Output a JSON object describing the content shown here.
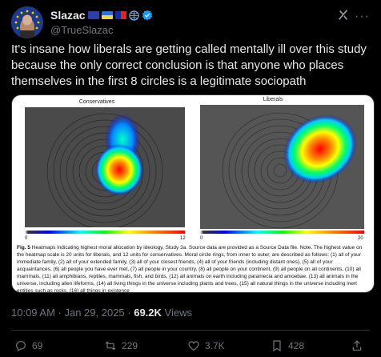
{
  "author": {
    "name": "Slazac",
    "handle": "@TrueSlazac",
    "flags": [
      "eu-flag-icon",
      "ukraine-flag-icon",
      "taiwan-flag-icon",
      "globe-icon"
    ],
    "verified": true
  },
  "post": {
    "text": "It's insane how liberals are getting called mentally ill over this study because the only correct conclusion is that anyone who places themselves in the first 8 circles is a legitimate sociopath"
  },
  "figure": {
    "left_title": "Conservatives",
    "right_title": "Liberals",
    "left_scale_min": "0",
    "left_scale_max": "12",
    "right_scale_min": "0",
    "right_scale_max": "20",
    "caption_label": "Fig. 5",
    "caption_text": " Heatmaps indicating highest moral allocation by ideology, Study 3a. Source data are provided as a Source Data file. Note. The highest value on the heatmap scale is 20 units for liberals, and 12 units for conservatives. Moral circle rings, from inner to outer, are described as follows: (1) all of your immediate family, (2) all of your extended family, (3) all of your closest friends, (4) all of your friends (including distant ones), (5) all of your acquaintances, (6) all people you have ever met, (7) all people in your country, (8) all people on your continent, (9) all people on all continents, (10) all mammals, (11) all amphibians, reptiles, mammals, fish, and birds, (12) all animals on earth including paramecia and amoebae, (13) all animals in the universe, including alien lifeforms, (14) all living things in the universe including plants and trees, (15) all natural things in the universe including inert entities such as rocks, (16) all things in existence"
  },
  "meta": {
    "timestamp": "10:09 AM · Jan 29, 2025 · ",
    "views_count": "69.2K",
    "views_label": " Views"
  },
  "actions": {
    "replies": "69",
    "reposts": "229",
    "likes": "3.7K",
    "bookmarks": "428"
  },
  "colors": {
    "background": "#000000",
    "text": "#e7e9ea",
    "muted": "#71767b",
    "verified": "#1d9bf0"
  }
}
